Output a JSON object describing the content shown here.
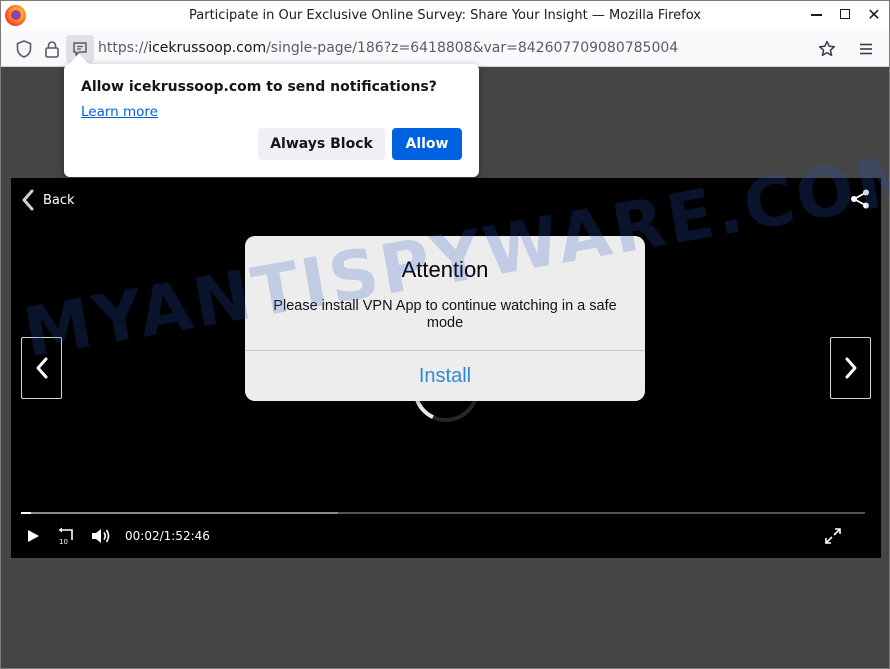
{
  "window": {
    "title": "Participate in Our Exclusive Online Survey: Share Your Insight — Mozilla Firefox"
  },
  "toolbar": {
    "url_prefix": "https://",
    "url_host": "icekrussoop.com",
    "url_path": "/single-page/186?z=6418808&var=842607709080785004"
  },
  "notification": {
    "question": "Allow icekrussoop.com to send notifications?",
    "learn_more": "Learn more",
    "block_label": "Always Block",
    "allow_label": "Allow"
  },
  "player": {
    "back_label": "Back",
    "time": "00:02/1:52:46",
    "progress": {
      "played_fraction": 0.012,
      "buffered_fraction": 0.375
    }
  },
  "modal": {
    "title": "Attention",
    "msg_before": "Please install ",
    "msg_app": "VPN App",
    "msg_after": " to continue watching in a safe mode",
    "button": "Install"
  },
  "watermark": "MYANTISPYWARE.COM",
  "colors": {
    "page_bg": "#454545",
    "allow_button": "#0061e0",
    "install_text": "#2f8ad4"
  }
}
